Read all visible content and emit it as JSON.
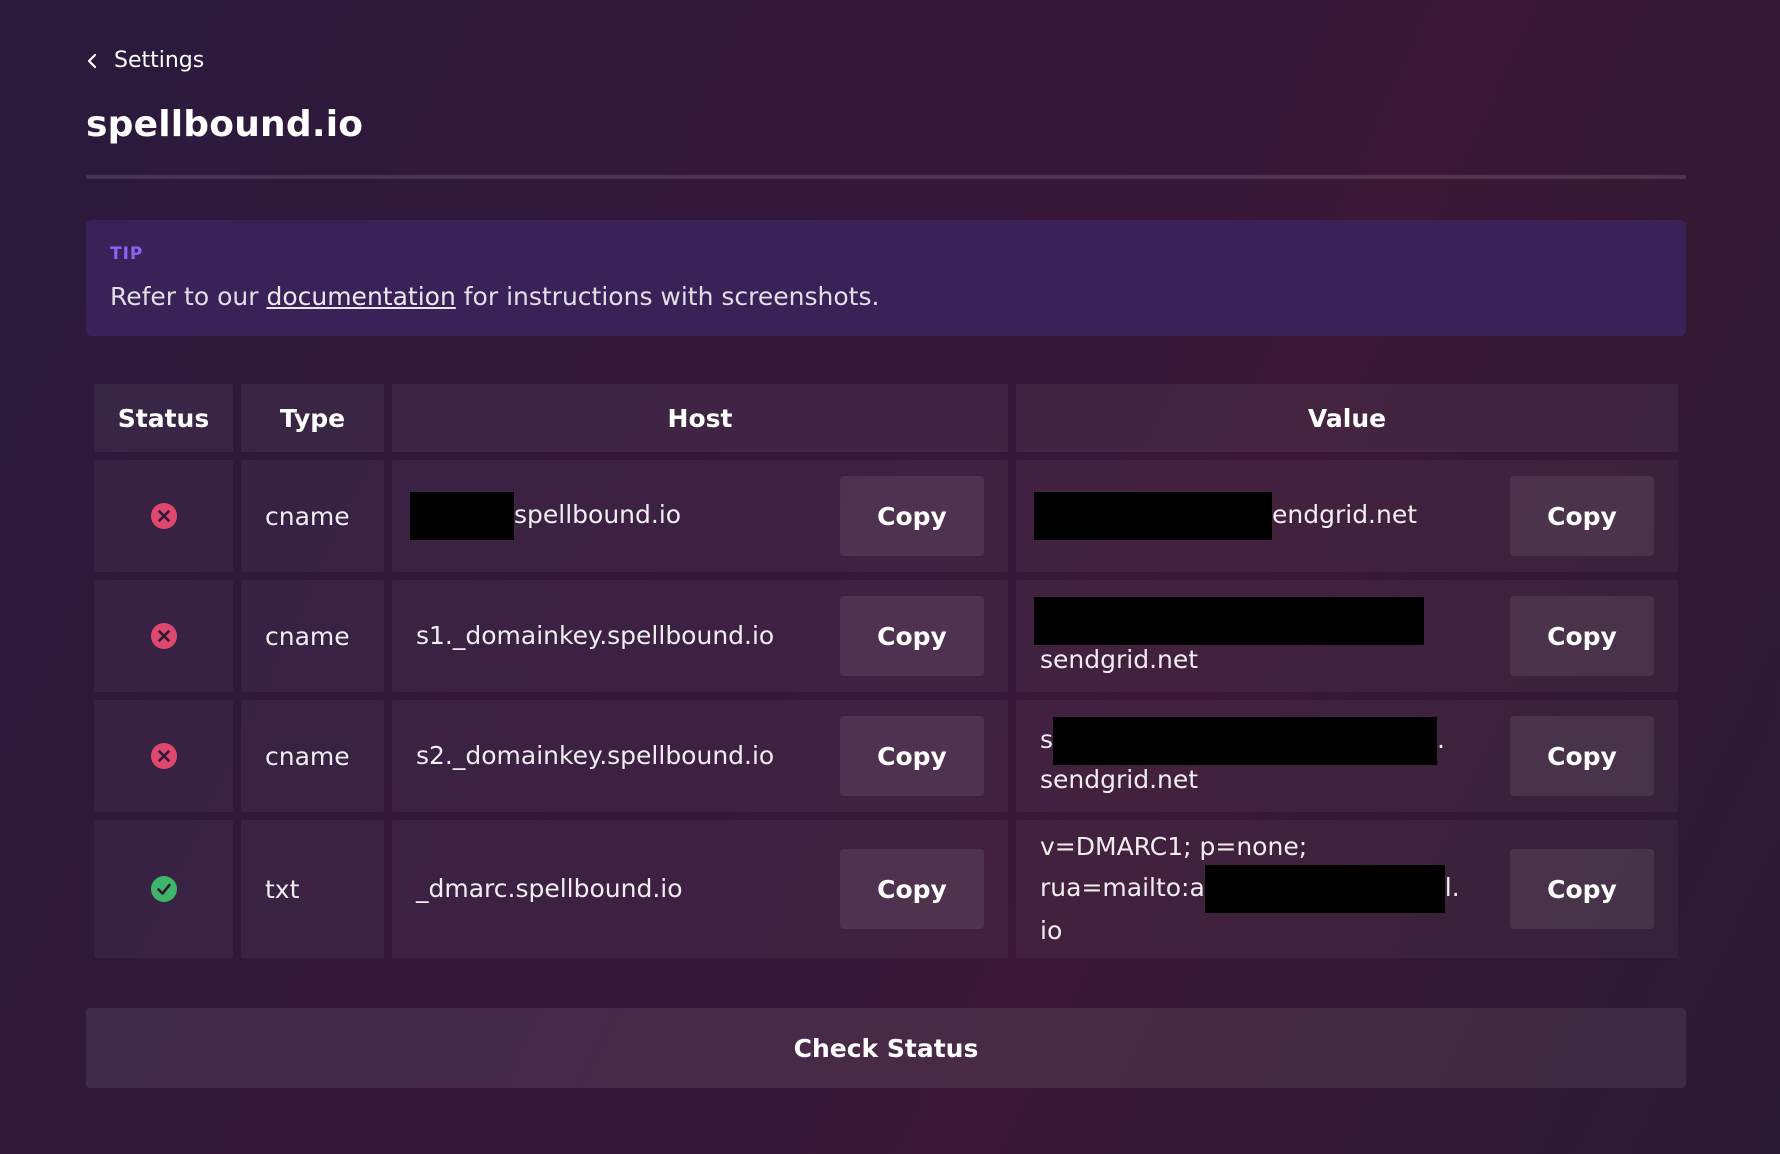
{
  "breadcrumb": {
    "label": "Settings"
  },
  "page": {
    "title": "spellbound.io"
  },
  "tip": {
    "label": "TIP",
    "text_before": "Refer to our ",
    "link_text": "documentation",
    "text_after": " for instructions with screenshots."
  },
  "table": {
    "headers": {
      "status": "Status",
      "type": "Type",
      "host": "Host",
      "value": "Value"
    },
    "copy_label": "Copy",
    "rows": [
      {
        "status": "error",
        "type": "cname",
        "host": "spellbound.io",
        "value": "endgrid.net"
      },
      {
        "status": "error",
        "type": "cname",
        "host": "s1._domainkey.spellbound.io",
        "value": "sendgrid.net"
      },
      {
        "status": "error",
        "type": "cname",
        "host": "s2._domainkey.spellbound.io",
        "value_prefix": "s",
        "value_suffix": ".",
        "value": "sendgrid.net"
      },
      {
        "status": "ok",
        "type": "txt",
        "host": "_dmarc.spellbound.io",
        "value_line1": "v=DMARC1; p=none;",
        "value_line2": "rua=mailto:a",
        "value_line2_end": "l.",
        "value_line3": "io"
      }
    ]
  },
  "colors": {
    "error": "#e0476f",
    "ok": "#3fb56a",
    "tip_label": "#8f63f2",
    "tip_bg": "#3a2258"
  },
  "actions": {
    "check_status": "Check Status"
  }
}
